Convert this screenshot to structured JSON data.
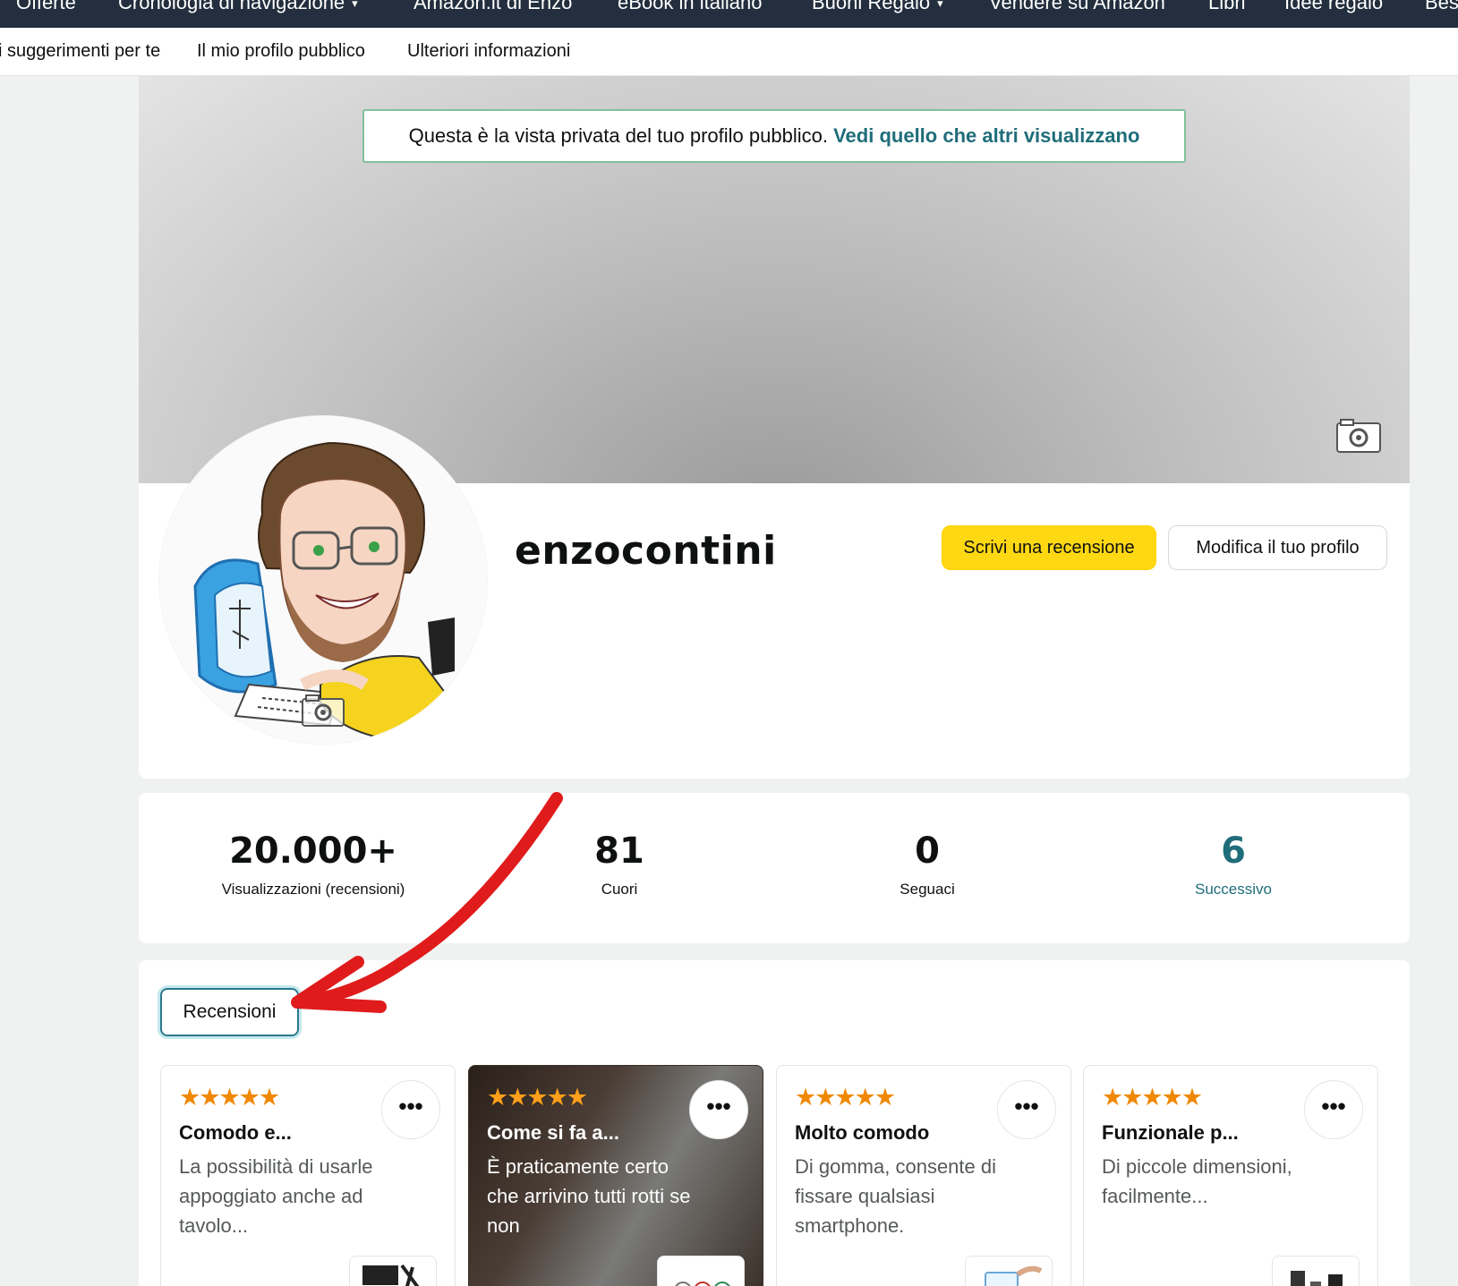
{
  "topnav": {
    "items": [
      {
        "label": "Offerte"
      },
      {
        "label": "Cronologia di navigazione",
        "has_dropdown": true
      },
      {
        "label": "Amazon.it di Enzo"
      },
      {
        "label": "eBook in italiano"
      },
      {
        "label": "Buoni Regalo",
        "has_dropdown": true
      },
      {
        "label": "Vendere su Amazon"
      },
      {
        "label": "Libri"
      },
      {
        "label": "Idee regalo"
      },
      {
        "label": "Bes"
      }
    ]
  },
  "subnav": {
    "items": [
      {
        "label": "i suggerimenti per te"
      },
      {
        "label": "Il mio profilo pubblico"
      },
      {
        "label": "Ulteriori informazioni"
      }
    ]
  },
  "banner": {
    "text": "Questa è la vista privata del tuo profilo pubblico.",
    "link": "Vedi quello che altri visualizzano"
  },
  "profile": {
    "username": "enzocontini",
    "write_review_label": "Scrivi una recensione",
    "edit_profile_label": "Modifica il tuo profilo"
  },
  "stats": [
    {
      "value": "20.000+",
      "label": "Visualizzazioni (recensioni)"
    },
    {
      "value": "81",
      "label": "Cuori"
    },
    {
      "value": "0",
      "label": "Seguaci"
    },
    {
      "value": "6",
      "label": "Successivo"
    }
  ],
  "reviews_tab": {
    "label": "Recensioni"
  },
  "reviews": [
    {
      "stars": "★★★★★",
      "title": "Comodo e...",
      "body": "La possibilità di usarle appoggiato anche ad tavolo..."
    },
    {
      "stars": "★★★★★",
      "title": "Come si fa a...",
      "body": "È praticamente certo che arrivino tutti rotti se non"
    },
    {
      "stars": "★★★★★",
      "title": "Molto comodo",
      "body": "Di gomma, consente di fissare qualsiasi smartphone."
    },
    {
      "stars": "★★★★★",
      "title": "Funzionale p...",
      "body": "Di piccole dimensioni, facilmente..."
    }
  ],
  "more_button_glyph": "•••",
  "colors": {
    "nav_bg": "#232f3e",
    "primary_button": "#ffd814",
    "link": "#1f6d7a",
    "star": "#f08804",
    "annotation_arrow": "#e01b1b"
  }
}
